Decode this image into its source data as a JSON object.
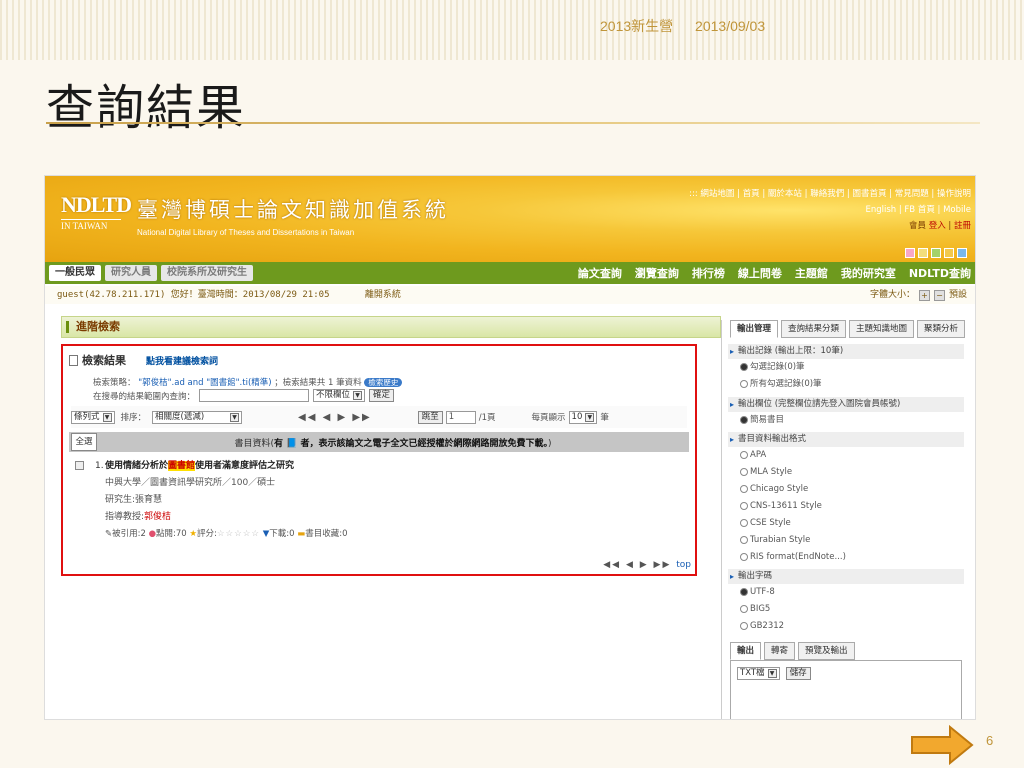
{
  "slide": {
    "header_left": "2013新生營",
    "header_right": "2013/09/03",
    "title": "查詢結果",
    "page_number": "6"
  },
  "site": {
    "logo_abbr": "NDLTD",
    "logo_sub": "IN TAIWAN",
    "logo_cn": "臺灣博碩士論文知識加值系統",
    "logo_en": "National Digital Library of Theses and Dissertations in Taiwan",
    "top_links_row1": "::: 網站地圖 | 首頁 | 關於本站 | 聯絡我們 | 圖書首頁 | 常見問題 | 操作說明",
    "top_links_row2": "English | FB 首頁 | Mobile",
    "member_label": "會員",
    "login_label": "登入",
    "register_label": "註冊",
    "color_dots": [
      "#f7a8c8",
      "#f2dd7a",
      "#a4d26a",
      "#f2c94c",
      "#7ab8e8"
    ]
  },
  "nav": {
    "tabs": [
      "一般民眾",
      "研究人員",
      "校院系所及研究生"
    ],
    "menu": [
      "論文查詢",
      "瀏覽查詢",
      "排行榜",
      "線上問卷",
      "主題館",
      "我的研究室",
      "NDLTD查詢"
    ]
  },
  "info": {
    "greeting": "guest(42.78.211.171) 您好！臺灣時間：2013/08/29 21:05",
    "logout": "離開系統",
    "font_label": "字體大小：",
    "font_plus": "+",
    "font_minus": "−",
    "font_reset": "預設"
  },
  "search": {
    "section_title": "進階檢索",
    "results_title": "檢索結果",
    "suggest_link": "點我看建議檢索詞",
    "strategy_label": "檢索策略：",
    "strategy_query": "\"郭俊桔\".ad and \"圖書館\".ti(精準)",
    "strategy_count": "；檢索結果共 1 筆資料",
    "history_pill": "檢索歷史",
    "within_label": "在搜尋的結果範圍內查詢：",
    "within_field": "不限欄位",
    "within_button": "確定",
    "display_mode": "條列式",
    "sort_label": "排序：",
    "sort_value": "相關度(遞減)",
    "pager": "◀◀ ◀ ▶ ▶▶",
    "jump_label": "跳至",
    "jump_value": "1",
    "page_total": "/1頁",
    "perpage_label": "每頁顯示",
    "perpage_value": "10",
    "perpage_unit": "筆",
    "select_all": "全選",
    "caption_pre": "書目資料(",
    "caption_bold": "有 📘 者，表示該論文之電子全文已經授權於網際網路開放免費下載。",
    "caption_post": ")",
    "bottom_pager": "◀◀ ◀ ▶ ▶▶",
    "top_link": "top"
  },
  "result": {
    "number": "1.",
    "title_pre": "使用情緒分析於",
    "title_hl": "圖書館",
    "title_post": "使用者滿意度評估之研究",
    "line2": "中興大學／圖書資訊學研究所／100／碩士",
    "line3": "研究生:張育慧",
    "advisor_label": "指導教授:",
    "advisor_name": "郭俊桔",
    "stats_cited": "被引用:2",
    "stats_clicks": "點閱:70",
    "stats_rating": "評分:",
    "stats_downloads": "下載:0",
    "stats_collect": "書目收藏:0"
  },
  "panel": {
    "tabs": [
      "輸出管理",
      "查詢結果分類",
      "主題知識地圖",
      "聚類分析"
    ],
    "sections": [
      {
        "head": "輸出記錄 (輸出上限：10筆)",
        "options": [
          {
            "label": "勾選記錄(0)筆",
            "checked": true
          },
          {
            "label": "所有勾選記錄(0)筆",
            "checked": false
          }
        ]
      },
      {
        "head": "輸出欄位 (完整欄位請先登入圖院會員帳號)",
        "options": [
          {
            "label": "簡易書目",
            "checked": true
          }
        ]
      },
      {
        "head": "書目資料輸出格式",
        "options": [
          {
            "label": "APA",
            "checked": false
          },
          {
            "label": "MLA Style",
            "checked": false
          },
          {
            "label": "Chicago Style",
            "checked": false
          },
          {
            "label": "CNS-13611 Style",
            "checked": false
          },
          {
            "label": "CSE Style",
            "checked": false
          },
          {
            "label": "Turabian Style",
            "checked": false
          },
          {
            "label": "RIS format(EndNote...)",
            "checked": false
          }
        ]
      },
      {
        "head": "輸出字碼",
        "options": [
          {
            "label": "UTF-8",
            "checked": true
          },
          {
            "label": "BIG5",
            "checked": false
          },
          {
            "label": "GB2312",
            "checked": false
          }
        ]
      }
    ],
    "out_tabs": [
      "輸出",
      "轉寄",
      "預覽及輸出"
    ],
    "format_value": "TXT檔",
    "save_button": "儲存"
  }
}
